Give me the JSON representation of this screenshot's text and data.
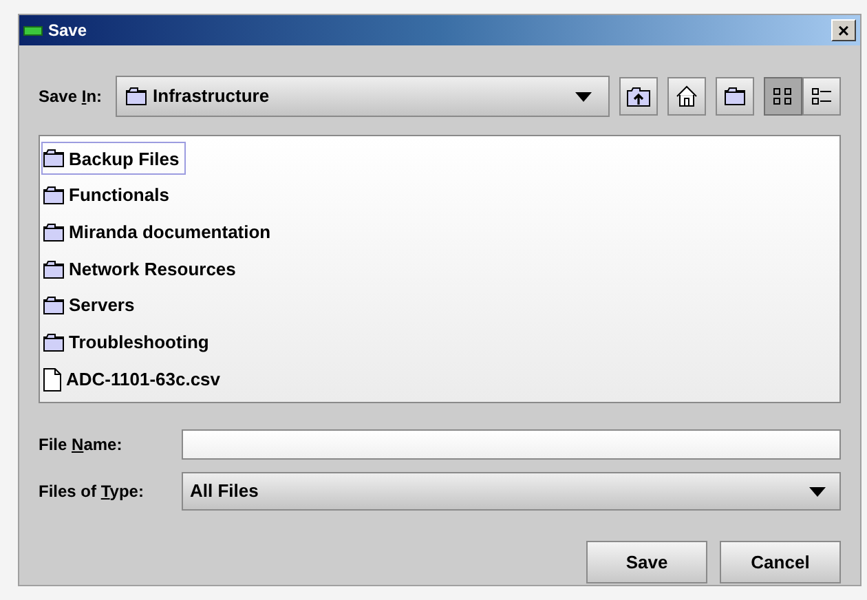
{
  "window": {
    "title": "Save",
    "close": "×"
  },
  "save_in": {
    "label_parts": [
      "Save ",
      "I",
      "n:"
    ],
    "value": "Infrastructure"
  },
  "toolbar": [
    {
      "kind": "up",
      "selected": false
    },
    {
      "kind": "home",
      "selected": false
    },
    {
      "kind": "new-folder",
      "selected": false
    },
    {
      "kind": "list",
      "selected": true
    },
    {
      "kind": "details",
      "selected": false
    }
  ],
  "files": [
    {
      "name": "Backup Files",
      "kind": "folder",
      "focused": true
    },
    {
      "name": "Functionals",
      "kind": "folder",
      "focused": false
    },
    {
      "name": "Miranda documentation",
      "kind": "folder",
      "focused": false
    },
    {
      "name": "Network Resources",
      "kind": "folder",
      "focused": false
    },
    {
      "name": "Servers",
      "kind": "folder",
      "focused": false
    },
    {
      "name": "Troubleshooting",
      "kind": "folder",
      "focused": false
    },
    {
      "name": "ADC-1101-63c.csv",
      "kind": "file",
      "focused": false
    }
  ],
  "file_name": {
    "label_parts": [
      "File ",
      "N",
      "ame:"
    ]
  },
  "files_of_type": {
    "label_parts": [
      "Files of ",
      "T",
      "ype:"
    ],
    "value": "All Files"
  },
  "buttons": [
    "Save",
    "Cancel"
  ]
}
